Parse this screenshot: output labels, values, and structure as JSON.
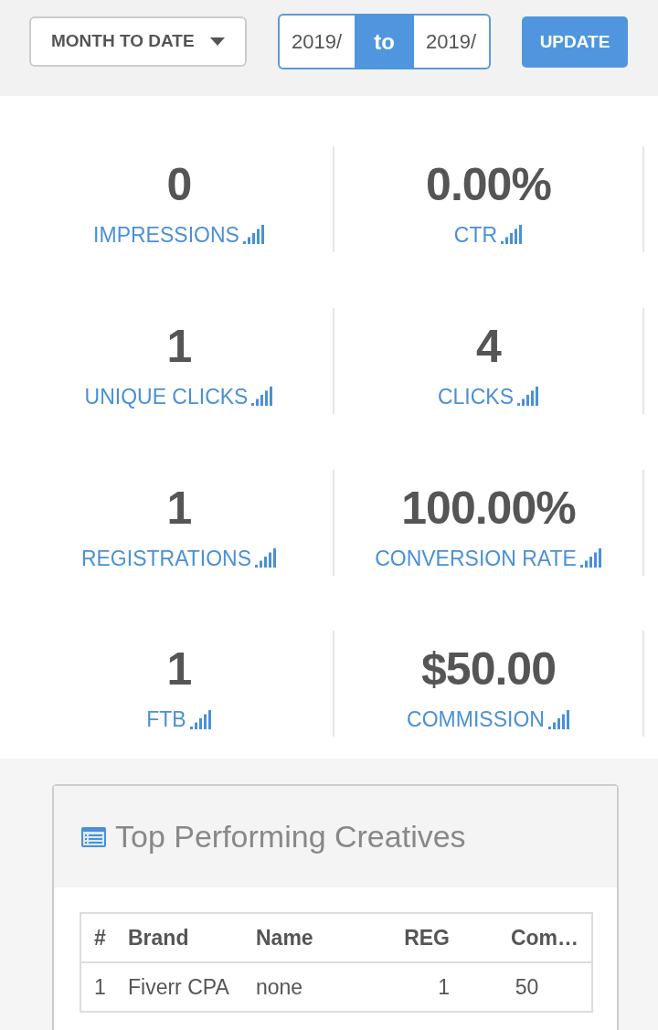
{
  "toolbar": {
    "range": "MONTH TO DATE",
    "date_from": "2019/",
    "separator": "to",
    "date_to": "2019/",
    "update": "UPDATE"
  },
  "stats": [
    {
      "value": "0",
      "label": "IMPRESSIONS"
    },
    {
      "value": "0.00%",
      "label": "CTR"
    },
    {
      "value": "1",
      "label": "UNIQUE CLICKS"
    },
    {
      "value": "4",
      "label": "CLICKS"
    },
    {
      "value": "1",
      "label": "REGISTRATIONS"
    },
    {
      "value": "100.00%",
      "label": "CONVERSION RATE"
    },
    {
      "value": "1",
      "label": "FTB"
    },
    {
      "value": "$50.00",
      "label": "COMMISSION"
    }
  ],
  "panel": {
    "title": "Top Performing Creatives",
    "table": {
      "columns": [
        "#",
        "Brand",
        "Name",
        "REG",
        "Com…"
      ],
      "rows": [
        [
          "1",
          "Fiverr CPA",
          "none",
          "1",
          "50"
        ]
      ]
    }
  }
}
